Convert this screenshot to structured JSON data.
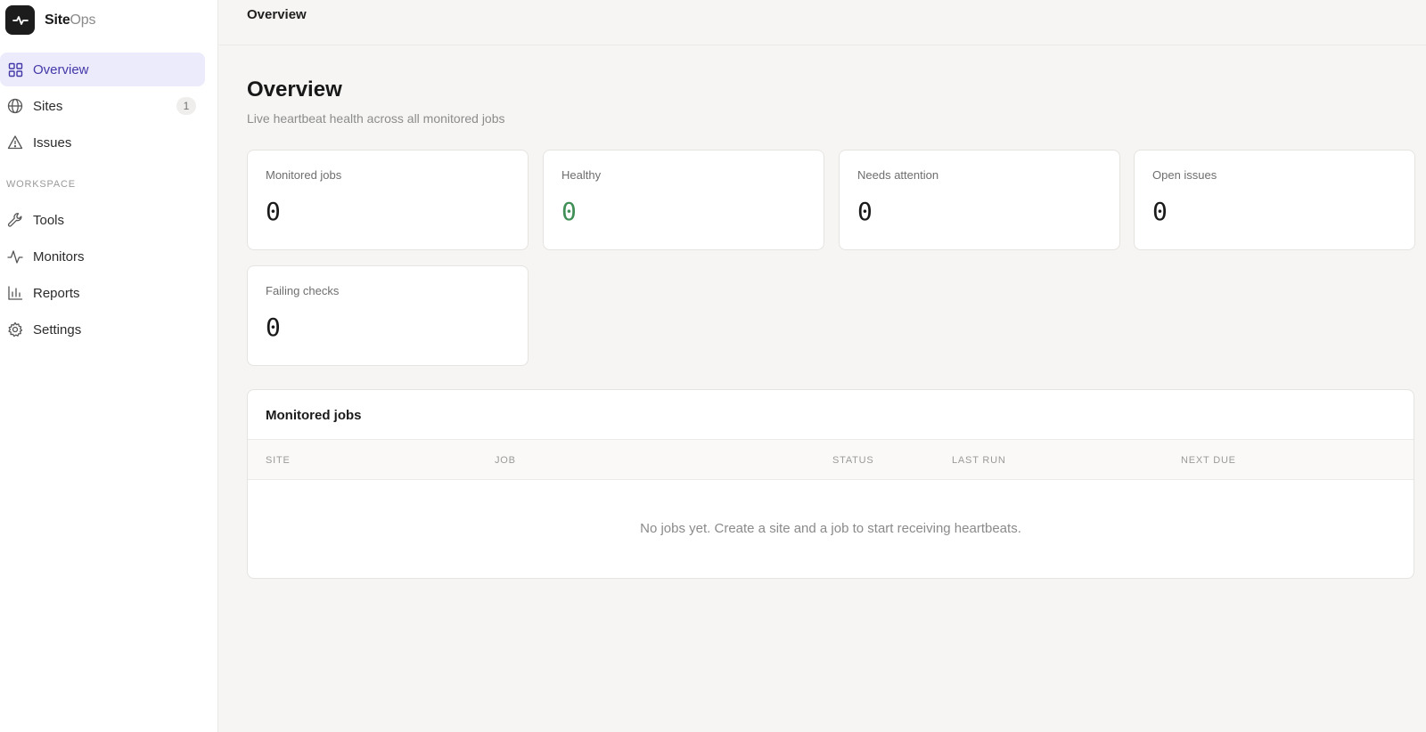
{
  "brand": {
    "name_primary": "Site",
    "name_secondary": "Ops"
  },
  "sidebar": {
    "items": [
      {
        "label": "Overview",
        "icon": "grid-icon",
        "active": true
      },
      {
        "label": "Sites",
        "icon": "globe-icon",
        "count": "1"
      },
      {
        "label": "Issues",
        "icon": "warning-icon"
      }
    ],
    "section_label": "WORKSPACE",
    "workspace_items": [
      {
        "label": "Tools",
        "icon": "wrench-icon"
      },
      {
        "label": "Monitors",
        "icon": "pulse-icon"
      },
      {
        "label": "Reports",
        "icon": "bar-chart-icon"
      },
      {
        "label": "Settings",
        "icon": "gear-icon"
      }
    ]
  },
  "topbar": {
    "title": "Overview"
  },
  "page": {
    "title": "Overview",
    "subtitle": "Live heartbeat health across all monitored jobs"
  },
  "stats": [
    {
      "label": "Monitored jobs",
      "value": "0"
    },
    {
      "label": "Healthy",
      "value": "0",
      "color": "#3f8f57"
    },
    {
      "label": "Needs attention",
      "value": "0"
    },
    {
      "label": "Open issues",
      "value": "0"
    },
    {
      "label": "Failing checks",
      "value": "0"
    }
  ],
  "jobs_table": {
    "title": "Monitored jobs",
    "columns": [
      "SITE",
      "JOB",
      "STATUS",
      "LAST RUN",
      "NEXT DUE"
    ],
    "empty_message": "No jobs yet. Create a site and a job to start receiving heartbeats."
  },
  "colors": {
    "accent": "#4338a8",
    "accent_bg": "#ecebfb",
    "success": "#3f8f57"
  }
}
